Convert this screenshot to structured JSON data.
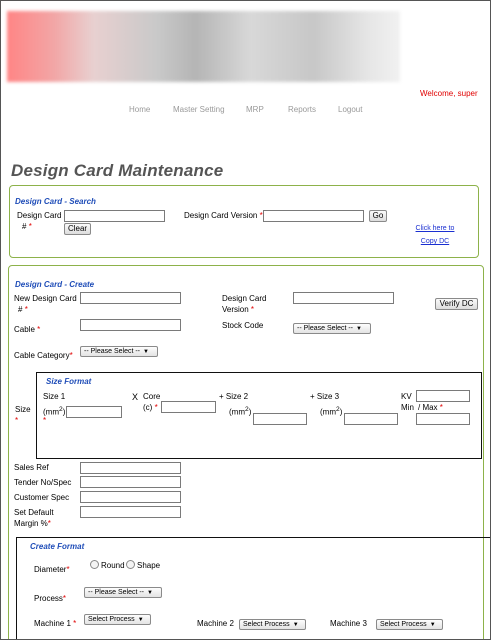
{
  "header": {
    "welcome": "Welcome, super",
    "nav": [
      "Home",
      "Master Setting",
      "MRP",
      "Reports",
      "Logout"
    ]
  },
  "page_title": "Design Card Maintenance",
  "search": {
    "legend": "Design Card - Search",
    "design_card_label": "Design Card",
    "design_card_hash": "#",
    "version_label": "Design Card Version",
    "go_label": "Go",
    "clear_label": "Clear",
    "copy_link_line1": "Click here to",
    "copy_link_line2": "Copy DC"
  },
  "create": {
    "legend": "Design Card - Create",
    "new_design_card_label": "New Design Card",
    "new_design_card_hash": "#",
    "design_card_label": "Design Card",
    "version_label": "Version",
    "verify_label": "Verify DC",
    "cable_label": "Cable",
    "stock_code_label": "Stock Code",
    "stock_code_select": "-- Please Select --",
    "cable_category_label": "Cable Category",
    "cable_category_select": "-- Please Select --",
    "size_label": "Size",
    "size_format": {
      "legend": "Size Format",
      "size1_label": "Size 1",
      "size1_unit": "(mm",
      "sup2": "2",
      "close_paren": ")",
      "x_core_x": "X",
      "x_core_label": "Core",
      "x_core_c": "(c)",
      "size2_label": "+ Size 2",
      "size2_unit": "(mm",
      "size3_label": "+ Size 3",
      "size3_unit": "(mm",
      "kv_label": "KV",
      "kv_min": "Min",
      "kv_max": "/ Max"
    },
    "sales_ref_label": "Sales Ref",
    "tender_label": "Tender No/Spec",
    "customer_spec_label": "Customer Spec",
    "margin_label_1": "Set Default",
    "margin_label_2": "Margin %"
  },
  "create_format": {
    "legend": "Create Format",
    "diameter_label": "Diameter",
    "round_label": "Round",
    "shape_label": "Shape",
    "process_label": "Process",
    "process_select": "-- Please Select --",
    "machine1_label": "Machine 1",
    "machine1_select": "Select Process",
    "machine2_label": "Machine 2",
    "machine2_select": "Select Process",
    "machine3_label": "Machine 3",
    "machine3_select": "Select Process"
  },
  "required_marker": "*"
}
